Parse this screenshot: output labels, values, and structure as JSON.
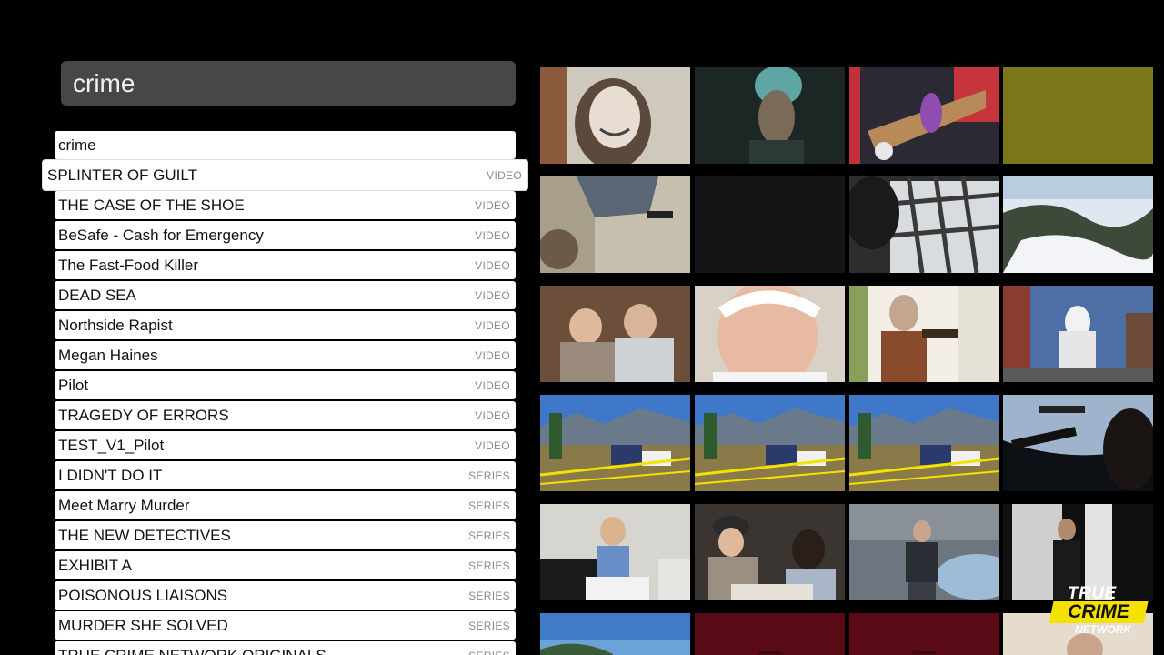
{
  "search": {
    "query": "crime"
  },
  "suggestion": "crime",
  "results": [
    {
      "title": "SPLINTER OF GUILT",
      "type": "VIDEO"
    },
    {
      "title": "THE CASE OF THE SHOE",
      "type": "VIDEO"
    },
    {
      "title": "BeSafe - Cash for Emergency",
      "type": "VIDEO"
    },
    {
      "title": "The Fast-Food Killer",
      "type": "VIDEO"
    },
    {
      "title": "DEAD SEA",
      "type": "VIDEO"
    },
    {
      "title": "Northside Rapist",
      "type": "VIDEO"
    },
    {
      "title": "Megan Haines",
      "type": "VIDEO"
    },
    {
      "title": "Pilot",
      "type": "VIDEO"
    },
    {
      "title": "TRAGEDY OF ERRORS",
      "type": "VIDEO"
    },
    {
      "title": "TEST_V1_Pilot",
      "type": "VIDEO"
    },
    {
      "title": "I DIDN'T DO IT",
      "type": "SERIES"
    },
    {
      "title": "Meet Marry Murder",
      "type": "SERIES"
    },
    {
      "title": "THE NEW DETECTIVES",
      "type": "SERIES"
    },
    {
      "title": "EXHIBIT A",
      "type": "SERIES"
    },
    {
      "title": "POISONOUS LIAISONS",
      "type": "SERIES"
    },
    {
      "title": "MURDER SHE SOLVED",
      "type": "SERIES"
    },
    {
      "title": "TRUE CRIME NETWORK ORIGINALS",
      "type": "SERIES"
    }
  ],
  "thumbnails": [
    "smiling-woman-portrait",
    "woman-in-headscarf",
    "woman-on-car",
    "olive-placeholder",
    "gun-on-beach",
    "dark-blank",
    "barred-window",
    "snowy-valley",
    "couple-portrait",
    "older-man",
    "masked-gunman",
    "capitol-street",
    "crime-scene-tape",
    "crime-scene-tape",
    "crime-scene-tape",
    "car-interior-night",
    "woman-reading-papers",
    "officer-and-woman",
    "officer-by-car",
    "woman-in-doorway",
    "coastline",
    "red-title-card",
    "red-title-card",
    "woman-portrait-partial"
  ],
  "logo": {
    "line1": "TRUE",
    "line2": "CRIME",
    "line3": "NETWORK"
  },
  "colors": {
    "background": "#000000",
    "search_box": "#474747",
    "logo_yellow": "#f5e100"
  }
}
